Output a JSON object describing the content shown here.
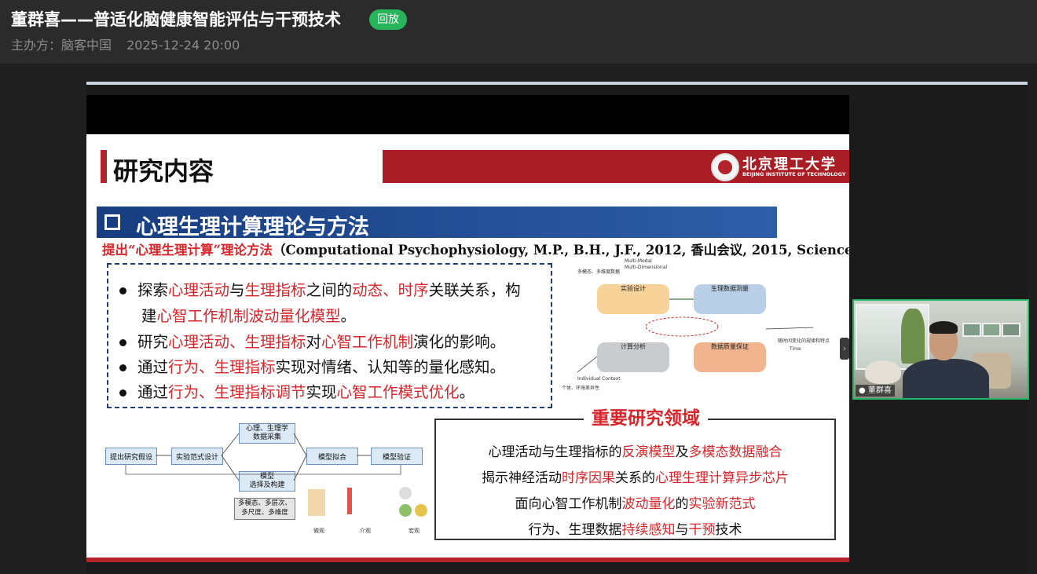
{
  "header": {
    "title": "董群喜——普适化脑健康智能评估与干预技术",
    "badge": "回放",
    "organizer": "主办方：脑客中国",
    "datetime": "2025-12-24 20:00"
  },
  "slide": {
    "title": "研究内容",
    "logo_cn": "北京理工大学",
    "logo_en": "BEIJING INSTITUTE OF TECHNOLOGY",
    "section_title": "心理生理计算理论与方法",
    "subtitle_red": "提出“心理生理计算”理论方法",
    "subtitle_rest": "（Computational Psychophysiology, M.P., B.H., J.F., 2012, 香山会议, 2015, Science)",
    "bullets": {
      "b1_a": "探索",
      "b1_b": "心理活动",
      "b1_c": "与",
      "b1_d": "生理指标",
      "b1_e": "之间的",
      "b1_f": "动态、时序",
      "b1_g": "关联关系，构",
      "b1_h": "建",
      "b1_i": "心智工作机制波动量化模型",
      "b1_j": "。",
      "b2_a": "研究",
      "b2_b": "心理活动、生理指标",
      "b2_c": "对",
      "b2_d": "心智工作机制",
      "b2_e": "演化的影响。",
      "b3_a": "通过",
      "b3_b": "行为、生理指标",
      "b3_c": "实现对情绪、认知等的量化感知。",
      "b4_a": "通过",
      "b4_b": "行为、生理指标调节",
      "b4_c": "实现",
      "b4_d": "心智工作模式优化",
      "b4_e": "。"
    },
    "diagram": {
      "multi_modal": "Multi-Modal",
      "multi_dim": "Multi-Dimensional",
      "multi_cn": "多模态、多维度数据",
      "exp_design": "实验设计",
      "physio_measure": "生理数据测量",
      "compute": "计算分析",
      "quality": "数据质量保证",
      "time": "Time",
      "individual": "Individual Context",
      "individual_cn": "个体、环境差异性",
      "time_cn": "随时间变化的规律和特点"
    },
    "flow": {
      "propose": "提出研究假设",
      "paradigm": "实验范式设计",
      "collect": "心理、生理学\n数据采集",
      "model_select": "模型\n选择及构建",
      "fit": "模型拟合",
      "verify": "模型验证",
      "multi": "多模态、多层次、\n多尺度、多维度",
      "micro": "微观",
      "meso": "介观",
      "macro": "宏观"
    },
    "key_title": "重要研究领域",
    "key": {
      "k1_a": "心理活动与生理指标的",
      "k1_b": "反演模型",
      "k1_c": "及",
      "k1_d": "多模态数据融合",
      "k2_a": "揭示神经活动",
      "k2_b": "时序因果",
      "k2_c": "关系的",
      "k2_d": "心理生理计算异步芯片",
      "k3_a": "面向心智工作机制",
      "k3_b": "波动量化",
      "k3_c": "的",
      "k3_d": "实验新范式",
      "k4_a": "行为、生理数据",
      "k4_b": "持续感知",
      "k4_c": "与",
      "k4_d": "干预",
      "k4_e": "技术"
    }
  },
  "camera": {
    "name": "董群喜",
    "collapse_arrow": "›"
  },
  "colors": {
    "accent_red": "#d7262b",
    "live_green": "#27b45a",
    "section_blue": "#173d80"
  }
}
